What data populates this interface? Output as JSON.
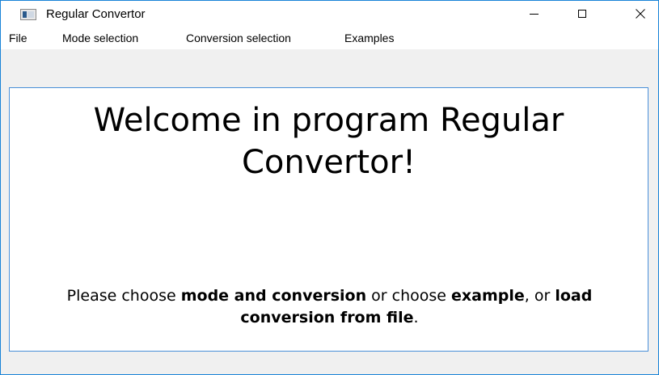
{
  "window": {
    "title": "Regular Convertor",
    "accent_color": "#1883d7"
  },
  "menu": {
    "items": [
      "File",
      "Mode selection",
      "Conversion selection",
      "Examples"
    ]
  },
  "content": {
    "welcome": "Welcome in program Regular Convertor!",
    "instructions": {
      "part1": "Please choose ",
      "bold1": "mode and conversion",
      "part2": " or choose ",
      "bold2": "example",
      "part3": ", or ",
      "bold3": "load conversion from file",
      "part4": "."
    }
  },
  "icons": {
    "app": "app-window-icon",
    "minimize": "minimize-icon",
    "maximize": "maximize-icon",
    "close": "close-icon"
  }
}
